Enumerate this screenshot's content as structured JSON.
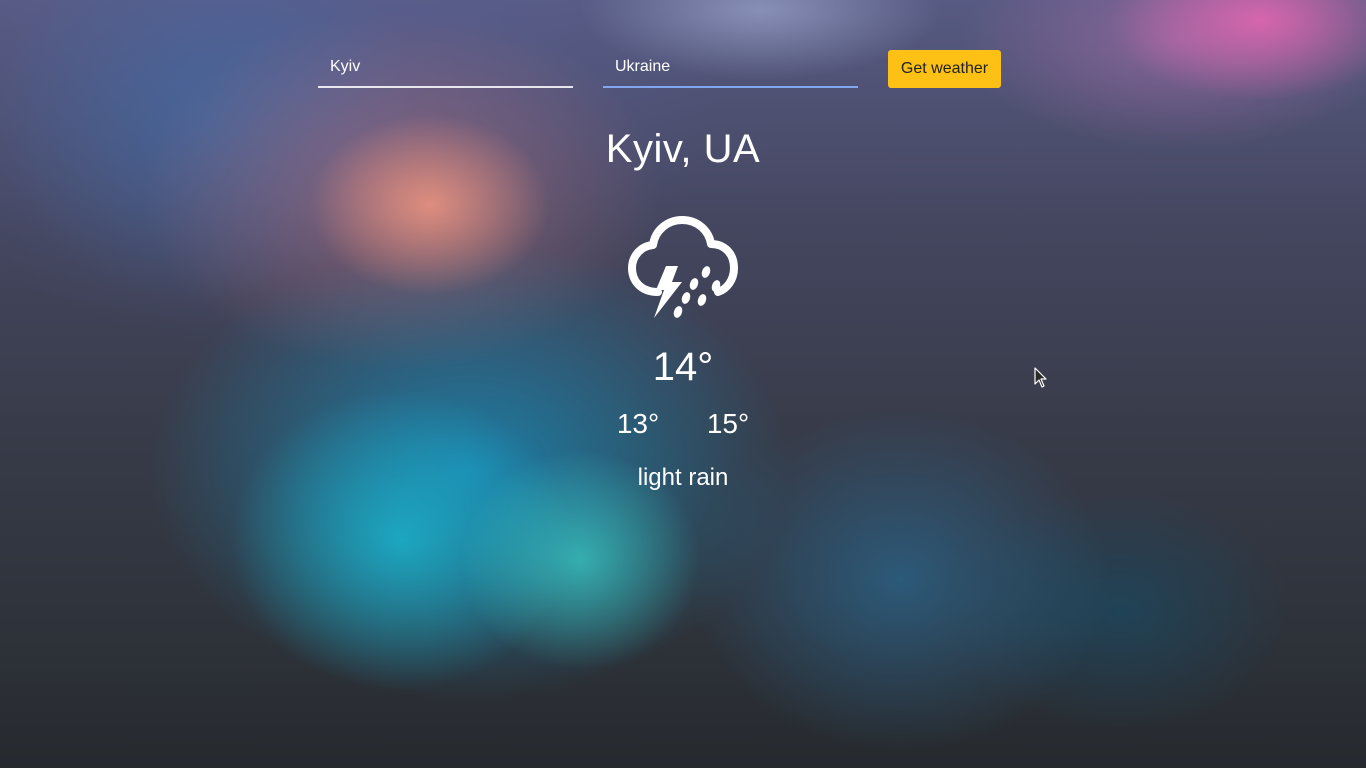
{
  "search": {
    "city_value": "Kyiv",
    "country_value": "Ukraine",
    "button_label": "Get weather"
  },
  "weather": {
    "location": "Kyiv, UA",
    "icon": "thunderstorm-rain-icon",
    "temperature": "14°",
    "temp_min": "13°",
    "temp_max": "15°",
    "description": "light rain"
  },
  "colors": {
    "button": "#fdc014",
    "focus_underline": "#7fa6ef",
    "text": "#ffffff"
  }
}
